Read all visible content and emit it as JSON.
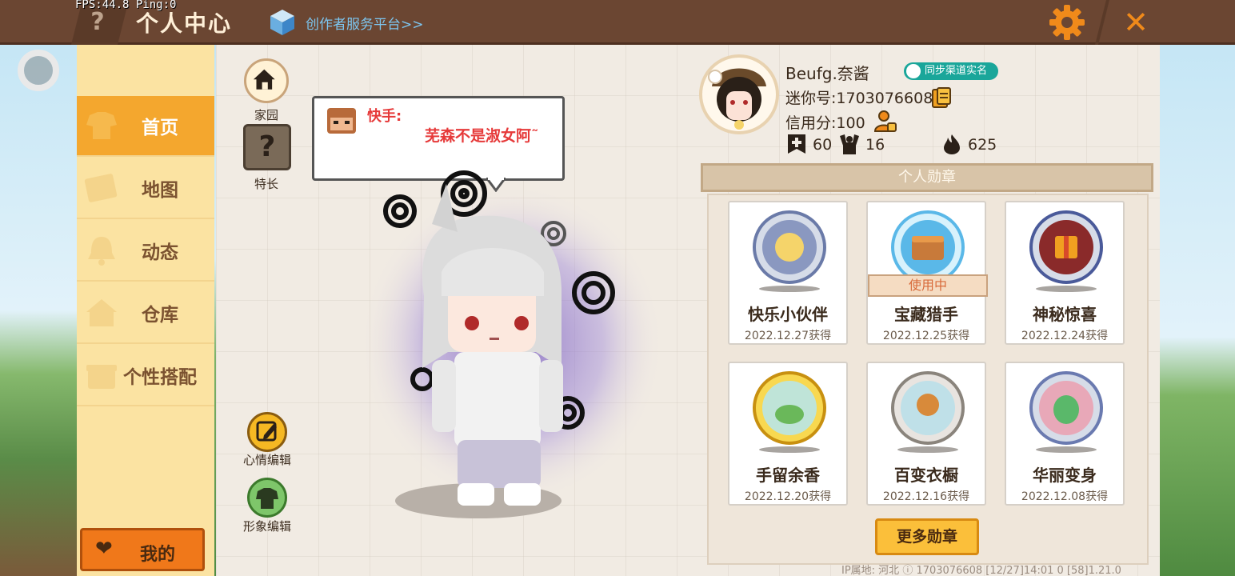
{
  "debug": {
    "fps": "FPS:44.8  Ping:0"
  },
  "header": {
    "help_symbol": "?",
    "title": "个人中心",
    "creator_link": "创作者服务平台>>",
    "close_symbol": "✕"
  },
  "sidebar": {
    "items": [
      {
        "label": "首页",
        "active": true
      },
      {
        "label": "地图"
      },
      {
        "label": "动态"
      },
      {
        "label": "仓库"
      },
      {
        "label": "个性搭配"
      }
    ],
    "mine_label": "我的"
  },
  "tools": {
    "home_label": "家园",
    "skill_label": "特长",
    "skill_symbol": "?",
    "mood_label": "心情编辑",
    "avatar_label": "形象编辑"
  },
  "speech": {
    "speaker": "快手:",
    "message": "芜森不是淑女阿˜"
  },
  "profile": {
    "username": "Beufg.奈酱",
    "realname_badge": "同步渠道实名",
    "mini_id": "迷你号:1703076608",
    "credit": "信用分:100",
    "stats": {
      "plus": "60",
      "fans": "16",
      "heat": "625"
    }
  },
  "medals": {
    "header": "个人勋章",
    "items": [
      {
        "name": "快乐小伙伴",
        "date": "2022.12.27获得",
        "color": "#8a98c0"
      },
      {
        "name": "宝藏猎手",
        "date": "2022.12.25获得",
        "color": "#5ab8e8",
        "tag": "使用中"
      },
      {
        "name": "神秘惊喜",
        "date": "2022.12.24获得",
        "color": "#4a5a9a"
      },
      {
        "name": "手留余香",
        "date": "2022.12.20获得",
        "color": "#f0c020"
      },
      {
        "name": "百变衣橱",
        "date": "2022.12.16获得",
        "color": "#b8b0a8"
      },
      {
        "name": "华丽变身",
        "date": "2022.12.08获得",
        "color": "#6a7ab0"
      }
    ],
    "more_label": "更多勋章"
  },
  "footer": {
    "text": "IP属地: 河北  ⓘ     1703076608  [12/27]14:01 0  [58]1.21.0"
  }
}
